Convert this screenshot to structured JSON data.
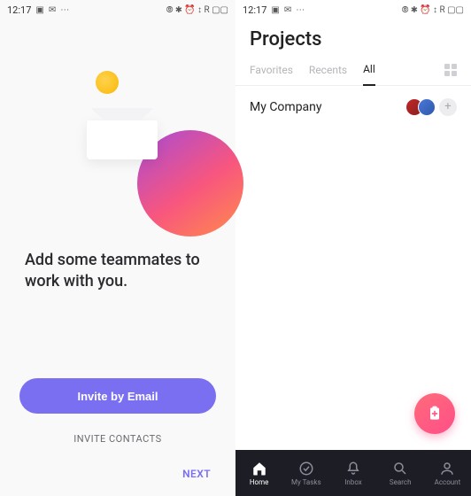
{
  "status": {
    "time": "12:17",
    "right_glyphs": "⦾ ✱ ⏰ ↕ R ▢▢"
  },
  "left": {
    "headline": "Add some teammates to work with you.",
    "invite_email": "Invite by Email",
    "invite_contacts": "INVITE CONTACTS",
    "next": "NEXT"
  },
  "right": {
    "title": "Projects",
    "tabs": {
      "favorites": "Favorites",
      "recents": "Recents",
      "all": "All"
    },
    "list": {
      "my_company": "My Company"
    },
    "tabbar": {
      "home": "Home",
      "tasks": "My Tasks",
      "inbox": "Inbox",
      "search": "Search",
      "account": "Account"
    }
  }
}
